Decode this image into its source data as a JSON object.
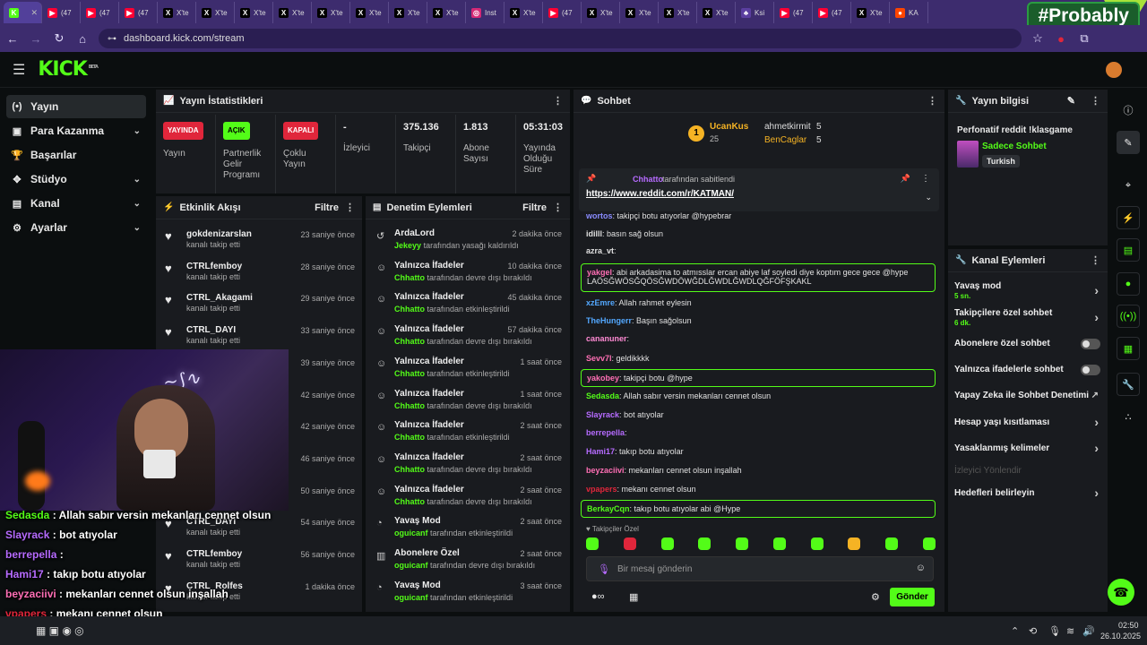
{
  "browser": {
    "tabs": [
      {
        "icon": "K",
        "label": "",
        "color": "#53fc18",
        "active": true
      },
      {
        "icon": "▶",
        "label": "(47",
        "color": "#ff0033"
      },
      {
        "icon": "▶",
        "label": "(47",
        "color": "#ff0033"
      },
      {
        "icon": "▶",
        "label": "(47",
        "color": "#ff0033"
      },
      {
        "icon": "X",
        "label": "X'te",
        "color": "#000"
      },
      {
        "icon": "X",
        "label": "X'te",
        "color": "#000"
      },
      {
        "icon": "X",
        "label": "X'te",
        "color": "#000"
      },
      {
        "icon": "X",
        "label": "X'te",
        "color": "#000"
      },
      {
        "icon": "X",
        "label": "X'te",
        "color": "#000"
      },
      {
        "icon": "X",
        "label": "X'te",
        "color": "#000"
      },
      {
        "icon": "X",
        "label": "X'te",
        "color": "#000"
      },
      {
        "icon": "X",
        "label": "X'te",
        "color": "#000"
      },
      {
        "icon": "◎",
        "label": "Inst",
        "color": "#d62976"
      },
      {
        "icon": "X",
        "label": "X'te",
        "color": "#000"
      },
      {
        "icon": "▶",
        "label": "(47",
        "color": "#ff0033"
      },
      {
        "icon": "X",
        "label": "X'te",
        "color": "#000"
      },
      {
        "icon": "X",
        "label": "X'te",
        "color": "#000"
      },
      {
        "icon": "X",
        "label": "X'te",
        "color": "#000"
      },
      {
        "icon": "X",
        "label": "X'te",
        "color": "#000"
      },
      {
        "icon": "♣",
        "label": "Ksi",
        "color": "#5b3fa0"
      },
      {
        "icon": "▶",
        "label": "(47",
        "color": "#ff0033"
      },
      {
        "icon": "▶",
        "label": "(47",
        "color": "#ff0033"
      },
      {
        "icon": "X",
        "label": "X'te",
        "color": "#000"
      },
      {
        "icon": "●",
        "label": "KA",
        "color": "#ff4500"
      }
    ],
    "url": "dashboard.kick.com/stream",
    "badge": "#Probably"
  },
  "nav": {
    "items": [
      {
        "label": "Yayın",
        "icon": "(•)",
        "active": true,
        "chev": false
      },
      {
        "label": "Para Kazanma",
        "icon": "▣",
        "chev": true
      },
      {
        "label": "Başarılar",
        "icon": "🏆",
        "chev": false
      },
      {
        "label": "Stüdyo",
        "icon": "✥",
        "chev": true
      },
      {
        "label": "Kanal",
        "icon": "▤",
        "chev": true
      },
      {
        "label": "Ayarlar",
        "icon": "⚙",
        "chev": true
      }
    ]
  },
  "stats": {
    "title": "Yayın İstatistikleri",
    "cells": [
      {
        "pill": "YAYINDA",
        "pillcolor": "#e0263b",
        "label": "Yayın"
      },
      {
        "pill": "AÇIK",
        "pillcolor": "#53fc18",
        "label": "Partnerlik Gelir Programı"
      },
      {
        "pill": "KAPALI",
        "pillcolor": "#e0263b",
        "label": "Çoklu Yayın"
      },
      {
        "value": "-",
        "label": "İzleyici"
      },
      {
        "value": "375.136",
        "label": "Takipçi"
      },
      {
        "value": "1.813",
        "label": "Abone Sayısı"
      },
      {
        "value": "05:31:03",
        "label": "Yayında Olduğu Süre"
      }
    ]
  },
  "activity": {
    "title": "Etkinlik Akışı",
    "filter": "Filtre",
    "rows": [
      {
        "name": "gokdenizarslan",
        "sub": "kanalı takip etti",
        "time": "23 saniye önce"
      },
      {
        "name": "CTRLfemboy",
        "sub": "kanalı takip etti",
        "time": "28 saniye önce"
      },
      {
        "name": "CTRL_Akagami",
        "sub": "kanalı takip etti",
        "time": "29 saniye önce"
      },
      {
        "name": "CTRL_DAYI",
        "sub": "kanalı takip etti",
        "time": "33 saniye önce"
      },
      {
        "name": "",
        "sub": "",
        "time": "39 saniye önce"
      },
      {
        "name": "",
        "sub": "",
        "time": "42 saniye önce"
      },
      {
        "name": "",
        "sub": "",
        "time": "42 saniye önce"
      },
      {
        "name": "",
        "sub": "",
        "time": "46 saniye önce"
      },
      {
        "name": "",
        "sub": "",
        "time": "50 saniye önce"
      },
      {
        "name": "CTRL_DAYI",
        "sub": "kanalı takip etti",
        "time": "54 saniye önce"
      },
      {
        "name": "CTRLfemboy",
        "sub": "kanalı takip etti",
        "time": "56 saniye önce"
      },
      {
        "name": "CTRL_Rolfes",
        "sub": "kanalı takip etti",
        "time": "1 dakika önce"
      }
    ]
  },
  "moderation": {
    "title": "Denetim Eylemleri",
    "filter": "Filtre",
    "rows": [
      {
        "icon": "↺",
        "name": "ArdaLord",
        "user": "Jekeyy",
        "action": "tarafından yasağı kaldırıldı",
        "time": "2 dakika önce"
      },
      {
        "icon": "☺",
        "name": "Yalnızca İfadeler",
        "user": "Chhatto",
        "action": "tarafından devre dışı bırakıldı",
        "time": "10 dakika önce"
      },
      {
        "icon": "☺",
        "name": "Yalnızca İfadeler",
        "user": "Chhatto",
        "action": "tarafından etkinleştirildi",
        "time": "45 dakika önce"
      },
      {
        "icon": "☺",
        "name": "Yalnızca İfadeler",
        "user": "Chhatto",
        "action": "tarafından devre dışı bırakıldı",
        "time": "57 dakika önce"
      },
      {
        "icon": "☺",
        "name": "Yalnızca İfadeler",
        "user": "Chhatto",
        "action": "tarafından etkinleştirildi",
        "time": "1 saat önce"
      },
      {
        "icon": "☺",
        "name": "Yalnızca İfadeler",
        "user": "Chhatto",
        "action": "tarafından devre dışı bırakıldı",
        "time": "1 saat önce"
      },
      {
        "icon": "☺",
        "name": "Yalnızca İfadeler",
        "user": "Chhatto",
        "action": "tarafından etkinleştirildi",
        "time": "2 saat önce"
      },
      {
        "icon": "☺",
        "name": "Yalnızca İfadeler",
        "user": "Chhatto",
        "action": "tarafından devre dışı bırakıldı",
        "time": "2 saat önce"
      },
      {
        "icon": "☺",
        "name": "Yalnızca İfadeler",
        "user": "Chhatto",
        "action": "tarafından devre dışı bırakıldı",
        "time": "2 saat önce"
      },
      {
        "icon": "◔",
        "name": "Yavaş Mod",
        "user": "oguicanf",
        "action": "tarafından etkinleştirildi",
        "time": "2 saat önce"
      },
      {
        "icon": "▥",
        "name": "Abonelere Özel",
        "user": "oguicanf",
        "action": "tarafından devre dışı bırakıldı",
        "time": "2 saat önce"
      },
      {
        "icon": "◔",
        "name": "Yavaş Mod",
        "user": "oguicanf",
        "action": "tarafından etkinleştirildi",
        "time": "3 saat önce"
      }
    ]
  },
  "chat": {
    "title": "Sohbet",
    "leader": {
      "rank": "1",
      "name": "UcanKus",
      "pts": "25",
      "second": "ahmetkirmit",
      "second_pts": "5",
      "third": "BenCaglar",
      "third_pts": "5"
    },
    "pinned": {
      "by": "Chhatto",
      "text": "tarafından sabitlendi",
      "link": "https://www.reddit.com/r/KATMAN/"
    },
    "messages": [
      {
        "user": "wortos",
        "color": "#8a8cff",
        "text": "takipçi botu atıyorlar @hypebrar",
        "box": false
      },
      {
        "user": "idilll",
        "color": "#e0e0e0",
        "text": "basın sağ olsun",
        "box": false
      },
      {
        "user": "azra_vt",
        "color": "#e0e0e0",
        "text": "",
        "box": false
      },
      {
        "user": "yakgel",
        "color": "#ff6fb5",
        "text": "abi arkadasima to atmısslar ercan abiye laf soyledi diye koptım gece gece @hype LAÖSĞWÖSĞQÖSĞWDÖWĞDLĞWDLĞWDLQĞFÖFŞKAKL",
        "box": true
      },
      {
        "user": "xzEmre",
        "color": "#53a8ff",
        "text": "Allah rahmet eylesin",
        "box": false
      },
      {
        "user": "TheHungerr",
        "color": "#53a8ff",
        "text": "Başın sağolsun",
        "box": false
      },
      {
        "user": "cananuner",
        "color": "#ff8ad4",
        "text": "",
        "box": false
      },
      {
        "user": "Sevv7l",
        "color": "#ff6fb5",
        "text": "geldikkkk",
        "box": false
      },
      {
        "user": "yakobey",
        "color": "#ff6fb5",
        "text": "takipçi botu @hype",
        "box": true
      },
      {
        "user": "Sedasda",
        "color": "#53fc18",
        "text": "Allah sabır versin mekanları cennet olsun",
        "box": false
      },
      {
        "user": "Slayrack",
        "color": "#b66bff",
        "text": "bot atıyolar",
        "box": false
      },
      {
        "user": "berrepella",
        "color": "#b66bff",
        "text": "",
        "box": false
      },
      {
        "user": "Hami17",
        "color": "#b66bff",
        "text": "takıp botu atıyolar",
        "box": false
      },
      {
        "user": "beyzaciivi",
        "color": "#ff6fb5",
        "text": "mekanları cennet olsun inşallah",
        "box": false
      },
      {
        "user": "vpapers",
        "color": "#e0263b",
        "text": "mekanı cennet olsun",
        "box": false
      },
      {
        "user": "BerkayCqn",
        "color": "#53fc18",
        "text": "takıp botu atıyolar abi @Hype",
        "box": true
      }
    ],
    "followers_only": "Takipçiler Özel",
    "input_placeholder": "Bir mesaj gönderin",
    "send": "Gönder"
  },
  "info": {
    "title": "Yayın bilgisi",
    "stream_title": "Perfonatif reddit !klasgame",
    "category": "Sadece Sohbet",
    "tag": "Turkish"
  },
  "channel_actions": {
    "title": "Kanal Eylemleri",
    "items": [
      {
        "label": "Yavaş mod",
        "sub": "5 sn.",
        "type": "arrow"
      },
      {
        "label": "Takipçilere özel sohbet",
        "sub": "6 dk.",
        "type": "arrow"
      },
      {
        "label": "Abonelere özel sohbet",
        "sub": "",
        "type": "toggle"
      },
      {
        "label": "Yalnızca ifadelerle sohbet",
        "sub": "",
        "type": "toggle"
      },
      {
        "label": "Yapay Zeka ile Sohbet Denetimi",
        "sub": "",
        "type": "ext"
      },
      {
        "label": "Hesap yaşı kısıtlaması",
        "sub": "",
        "type": "arrow"
      },
      {
        "label": "Yasaklanmış kelimeler",
        "sub": "",
        "type": "arrow"
      },
      {
        "label": "İzleyici Yönlendir",
        "sub": "",
        "type": "disabled"
      },
      {
        "label": "Hedefleri belirleyin",
        "sub": "",
        "type": "arrow"
      }
    ]
  },
  "overlay_chat": [
    {
      "user": "Sedasda",
      "color": "#53fc18",
      "text": "Allah sabır versin mekanları cennet olsun"
    },
    {
      "user": "Slayrack",
      "color": "#b66bff",
      "text": "bot atıyolar"
    },
    {
      "user": "berrepella",
      "color": "#b66bff",
      "text": ""
    },
    {
      "user": "Hami17",
      "color": "#b66bff",
      "text": "takıp botu atıyolar"
    },
    {
      "user": "beyzaciivi",
      "color": "#ff6fb5",
      "text": "mekanları cennet olsun inşallah"
    },
    {
      "user": "vpapers",
      "color": "#e0263b",
      "text": "mekanı cennet olsun"
    },
    {
      "user": "BerkayCqn",
      "color": "#53fc18",
      "text": "takıp botu atıyolar abi @Hype"
    }
  ],
  "taskbar": {
    "time": "02:50",
    "date": "26.10.2025"
  },
  "colors": {
    "kick_green": "#53fc18",
    "panel": "#191b1f",
    "bg": "#0b0e0f",
    "browser": "#3d2c6e"
  }
}
